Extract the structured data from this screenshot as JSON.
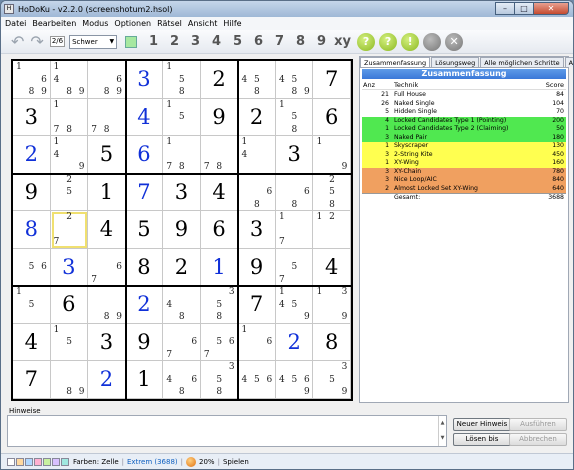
{
  "window": {
    "title": "HoDoKu - v2.2.0  (screenshotum2.hsol)",
    "minimize": "–",
    "maximize": "□",
    "close": "✕"
  },
  "menu": [
    "Datei",
    "Bearbeiten",
    "Modus",
    "Optionen",
    "Rätsel",
    "Ansicht",
    "Hilfe"
  ],
  "toolbar": {
    "undo_icon": "undo-arrow",
    "redo_icon": "redo-arrow",
    "digit_mode_icon": "2/6",
    "level_select": "Schwer",
    "numbers": [
      "1",
      "2",
      "3",
      "4",
      "5",
      "6",
      "7",
      "8",
      "9"
    ],
    "xy_label": "xy",
    "hint_buttons": [
      "?",
      "?",
      "!"
    ]
  },
  "grid": [
    [
      {
        "c": [
          1,
          6,
          8,
          9
        ]
      },
      {
        "c": [
          1,
          4,
          8,
          9
        ]
      },
      {
        "c": [
          6,
          8,
          9
        ]
      },
      {
        "v": 3,
        "b": 1
      },
      {
        "c": [
          1,
          5,
          8
        ]
      },
      {
        "v": 2
      },
      {
        "c": [
          4,
          5,
          8
        ]
      },
      {
        "c": [
          4,
          5,
          8,
          9
        ]
      },
      {
        "v": 7
      }
    ],
    [
      {
        "v": 3
      },
      {
        "c": [
          1,
          7,
          8
        ]
      },
      {
        "c": [
          7,
          8
        ]
      },
      {
        "v": 4,
        "b": 1
      },
      {
        "c": [
          1,
          5
        ]
      },
      {
        "v": 9
      },
      {
        "v": 2
      },
      {
        "c": [
          1,
          5,
          8
        ]
      },
      {
        "v": 6
      }
    ],
    [
      {
        "v": 2,
        "b": 1
      },
      {
        "c": [
          1,
          4,
          9
        ]
      },
      {
        "v": 5
      },
      {
        "v": 6,
        "b": 1
      },
      {
        "c": [
          1,
          7,
          8
        ]
      },
      {
        "c": [
          7,
          8
        ]
      },
      {
        "c": [
          1,
          4
        ]
      },
      {
        "v": 3
      },
      {
        "c": [
          1,
          9
        ]
      }
    ],
    [
      {
        "v": 9
      },
      {
        "c": [
          2,
          5
        ]
      },
      {
        "v": 1
      },
      {
        "v": 7,
        "b": 1
      },
      {
        "v": 3
      },
      {
        "v": 4
      },
      {
        "c": [
          6,
          8
        ]
      },
      {
        "c": [
          6,
          8
        ]
      },
      {
        "c": [
          2,
          5,
          8
        ]
      }
    ],
    [
      {
        "v": 8,
        "b": 1
      },
      {
        "c": [
          2,
          7
        ],
        "sel": 1
      },
      {
        "v": 4
      },
      {
        "v": 5
      },
      {
        "v": 9
      },
      {
        "v": 6
      },
      {
        "v": 3
      },
      {
        "c": [
          1,
          7
        ]
      },
      {
        "c": [
          1,
          2
        ]
      }
    ],
    [
      {
        "c": [
          5,
          6
        ]
      },
      {
        "v": 3,
        "b": 1
      },
      {
        "c": [
          6,
          7
        ]
      },
      {
        "v": 8
      },
      {
        "v": 2
      },
      {
        "v": 1,
        "b": 1
      },
      {
        "v": 9
      },
      {
        "c": [
          5,
          7
        ]
      },
      {
        "v": 4
      }
    ],
    [
      {
        "c": [
          1,
          5
        ]
      },
      {
        "v": 6
      },
      {
        "c": [
          8,
          9
        ]
      },
      {
        "v": 2,
        "b": 1
      },
      {
        "c": [
          4,
          8
        ]
      },
      {
        "c": [
          3,
          5,
          8
        ]
      },
      {
        "v": 7
      },
      {
        "c": [
          1,
          4,
          5,
          9
        ]
      },
      {
        "c": [
          1,
          3,
          9
        ]
      }
    ],
    [
      {
        "v": 4
      },
      {
        "c": [
          1,
          5
        ]
      },
      {
        "v": 3
      },
      {
        "v": 9
      },
      {
        "c": [
          6,
          7
        ]
      },
      {
        "c": [
          5,
          6,
          7
        ]
      },
      {
        "c": [
          1,
          6
        ]
      },
      {
        "v": 2,
        "b": 1
      },
      {
        "v": 8
      }
    ],
    [
      {
        "v": 7
      },
      {
        "c": [
          8,
          9
        ]
      },
      {
        "v": 2,
        "b": 1
      },
      {
        "v": 1
      },
      {
        "c": [
          4,
          6,
          8
        ]
      },
      {
        "c": [
          3,
          5,
          8
        ]
      },
      {
        "c": [
          4,
          5,
          6
        ]
      },
      {
        "c": [
          4,
          5,
          6,
          9
        ]
      },
      {
        "c": [
          3,
          5,
          9
        ]
      }
    ]
  ],
  "panel": {
    "tabs": [
      "Zusammenfassung",
      "Lösungsweg",
      "Alle möglichen Schritte",
      "Aktive Zelle"
    ],
    "header": "Zusammenfassung",
    "col_count": "Anz",
    "col_technique": "Technik",
    "col_score": "Score",
    "rows": [
      {
        "n": "21",
        "t": "Full House",
        "s": "84",
        "color": "#ffffff"
      },
      {
        "n": "26",
        "t": "Naked Single",
        "s": "104",
        "color": "#ffffff"
      },
      {
        "n": "5",
        "t": "Hidden Single",
        "s": "70",
        "color": "#ffffff"
      },
      {
        "n": "4",
        "t": "Locked Candidates Type 1 (Pointing)",
        "s": "200",
        "color": "#50e850"
      },
      {
        "n": "1",
        "t": "Locked Candidates Type 2 (Claiming)",
        "s": "50",
        "color": "#50e850"
      },
      {
        "n": "3",
        "t": "Naked Pair",
        "s": "180",
        "color": "#50e850"
      },
      {
        "n": "1",
        "t": "Skyscraper",
        "s": "130",
        "color": "#ffff50"
      },
      {
        "n": "3",
        "t": "2-String Kite",
        "s": "450",
        "color": "#ffff50"
      },
      {
        "n": "1",
        "t": "XY-Wing",
        "s": "160",
        "color": "#ffff50"
      },
      {
        "n": "3",
        "t": "XY-Chain",
        "s": "780",
        "color": "#f0a060"
      },
      {
        "n": "3",
        "t": "Nice Loop/AIC",
        "s": "840",
        "color": "#f0a060"
      },
      {
        "n": "2",
        "t": "Almost Locked Set XY-Wing",
        "s": "640",
        "color": "#f0a060"
      },
      {
        "n": "",
        "t": "Gesamt:",
        "s": "3688",
        "color": "#ffffff"
      }
    ]
  },
  "hints": {
    "label": "Hinweise",
    "new_hint": "Neuer Hinweis",
    "execute": "Ausführen",
    "solve": "Lösen bis",
    "cancel": "Abbrechen"
  },
  "status": {
    "colors_label": "Farben: Zelle",
    "level": "Extrem (3688)",
    "percent": "20%",
    "mode": "Spielen"
  }
}
